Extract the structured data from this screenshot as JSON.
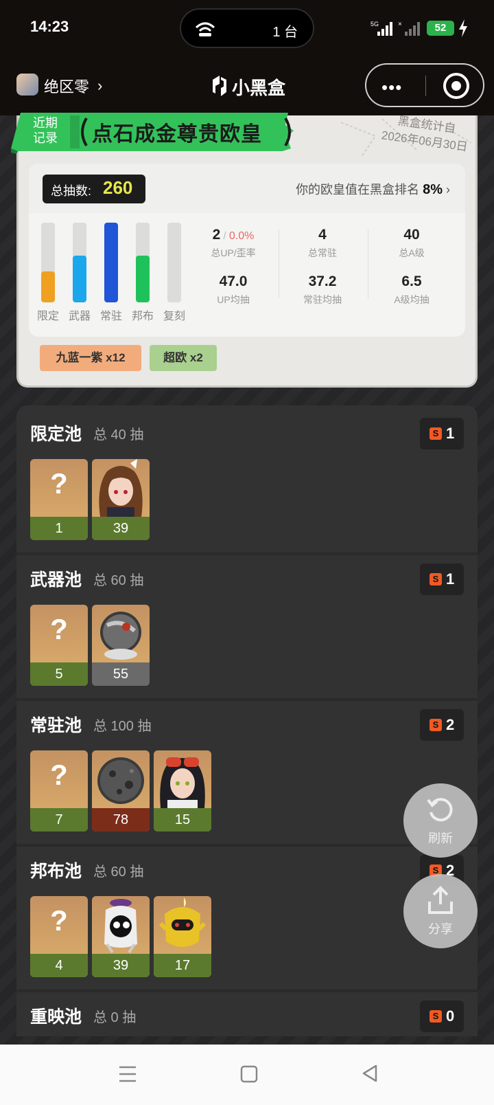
{
  "status_bar": {
    "time": "14:23",
    "island_count": "1 台",
    "signal1_label": "5G",
    "battery": "52"
  },
  "header": {
    "app_name": "绝区零",
    "brand": "小黑盒",
    "menu_icon": "more-dots-icon",
    "close_icon": "target-icon"
  },
  "summary": {
    "banner_label": "近期记录",
    "banner_title": "点石成金尊贵欧皇",
    "stat_source": "黑盒统计自",
    "stat_date": "2026年06月30日",
    "total_label": "总抽数:",
    "total_value": "260",
    "rank_text": "你的欧皇值在黑盒排名",
    "rank_value": "8%",
    "bars": [
      {
        "label": "限定",
        "fill": 0.39,
        "color": "#f0a020"
      },
      {
        "label": "武器",
        "fill": 0.59,
        "color": "#1aa7ec"
      },
      {
        "label": "常驻",
        "fill": 1.0,
        "color": "#1f55d6"
      },
      {
        "label": "邦布",
        "fill": 0.59,
        "color": "#1fc25a"
      },
      {
        "label": "复刻",
        "fill": 0.0,
        "color": "#bbbbbb"
      }
    ],
    "metrics": [
      {
        "value": "2",
        "sub": "0.0%",
        "label": "总UP/歪率"
      },
      {
        "value": "4",
        "label": "总常驻"
      },
      {
        "value": "40",
        "label": "总A级"
      },
      {
        "value": "47.0",
        "label": "UP均抽"
      },
      {
        "value": "37.2",
        "label": "常驻均抽"
      },
      {
        "value": "6.5",
        "label": "A级均抽"
      }
    ],
    "tags": [
      {
        "text": "九蓝一紫 x12",
        "color": "#f2ac7c"
      },
      {
        "text": "超欧 x2",
        "color": "#a9d08e"
      }
    ]
  },
  "pools": [
    {
      "name": "限定池",
      "total": "总 40 抽",
      "s_count": "1",
      "cards": [
        {
          "type": "unknown",
          "count": "1",
          "band": "green"
        },
        {
          "type": "girl-brown",
          "count": "39",
          "band": "green"
        }
      ]
    },
    {
      "name": "武器池",
      "total": "总 60 抽",
      "s_count": "1",
      "cards": [
        {
          "type": "unknown",
          "count": "5",
          "band": "green"
        },
        {
          "type": "orb",
          "count": "55",
          "band": "gray"
        }
      ]
    },
    {
      "name": "常驻池",
      "total": "总 100 抽",
      "s_count": "2",
      "cards": [
        {
          "type": "unknown",
          "count": "7",
          "band": "green"
        },
        {
          "type": "iron-ball",
          "count": "78",
          "band": "red"
        },
        {
          "type": "girl-goggles",
          "count": "15",
          "band": "green"
        }
      ]
    },
    {
      "name": "邦布池",
      "total": "总 60 抽",
      "s_count": "2",
      "cards": [
        {
          "type": "unknown",
          "count": "4",
          "band": "green"
        },
        {
          "type": "bangboo-black",
          "count": "39",
          "band": "green"
        },
        {
          "type": "bangboo-yellow",
          "count": "17",
          "band": "green"
        }
      ]
    },
    {
      "name": "重映池",
      "total": "总 0 抽",
      "s_count": "0",
      "cards": []
    }
  ],
  "fabs": {
    "refresh": "刷新",
    "share": "分享"
  },
  "nav": {
    "menu_icon": "menu-icon",
    "home_icon": "home-square-icon",
    "back_icon": "back-triangle-icon"
  },
  "colors": {
    "band_green": "#5b7a2e",
    "band_red": "#7c2d1a",
    "band_gray": "#6a6a6a",
    "accent_yellow": "#e8e84a",
    "banner_green": "#33c25a"
  }
}
